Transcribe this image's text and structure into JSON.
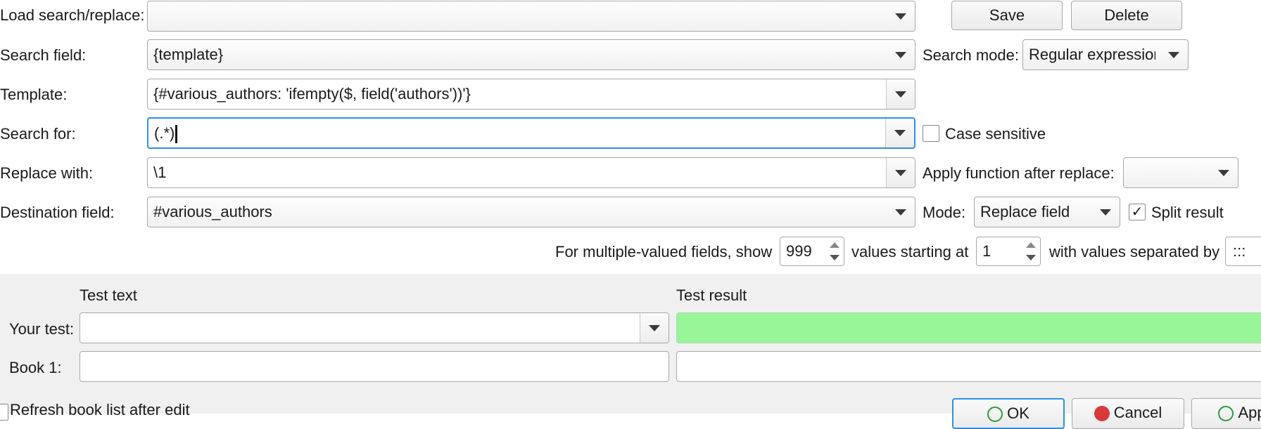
{
  "form": {
    "load_label": "Load search/replace:",
    "load_value": "",
    "save_label": "Save",
    "delete_label": "Delete",
    "search_field_label": "Search field:",
    "search_field_value": "{template}",
    "search_mode_label": "Search mode:",
    "search_mode_value": "Regular expression",
    "template_label": "Template:",
    "template_value": "{#various_authors: 'ifempty($, field('authors'))'}",
    "search_for_label": "Search for:",
    "search_for_value": "(.*)",
    "case_sensitive_label": "Case sensitive",
    "replace_with_label": "Replace with:",
    "replace_with_value": "\\1",
    "apply_function_label": "Apply function after replace:",
    "apply_function_value": "",
    "destination_label": "Destination field:",
    "destination_value": "#various_authors",
    "mode_label": "Mode:",
    "mode_value": "Replace field",
    "split_result_label": "Split result",
    "split_result_checked": "✓",
    "multi_show_label": "For multiple-valued fields, show",
    "multi_show_value": "999",
    "starting_at_label": "values starting at",
    "starting_at_value": "1",
    "separated_label": "with values separated by",
    "separated_value": ":::"
  },
  "test": {
    "test_text_header": "Test text",
    "test_result_header": "Test result",
    "your_test_label": "Your test:",
    "your_test_value": "",
    "book1_label": "Book 1:",
    "book1_value": "",
    "result_color": "#98f598"
  },
  "footer": {
    "refresh_label": "Refresh book list after edit",
    "ok_label": "OK",
    "cancel_label": "Cancel",
    "apply_label": "Apply"
  }
}
